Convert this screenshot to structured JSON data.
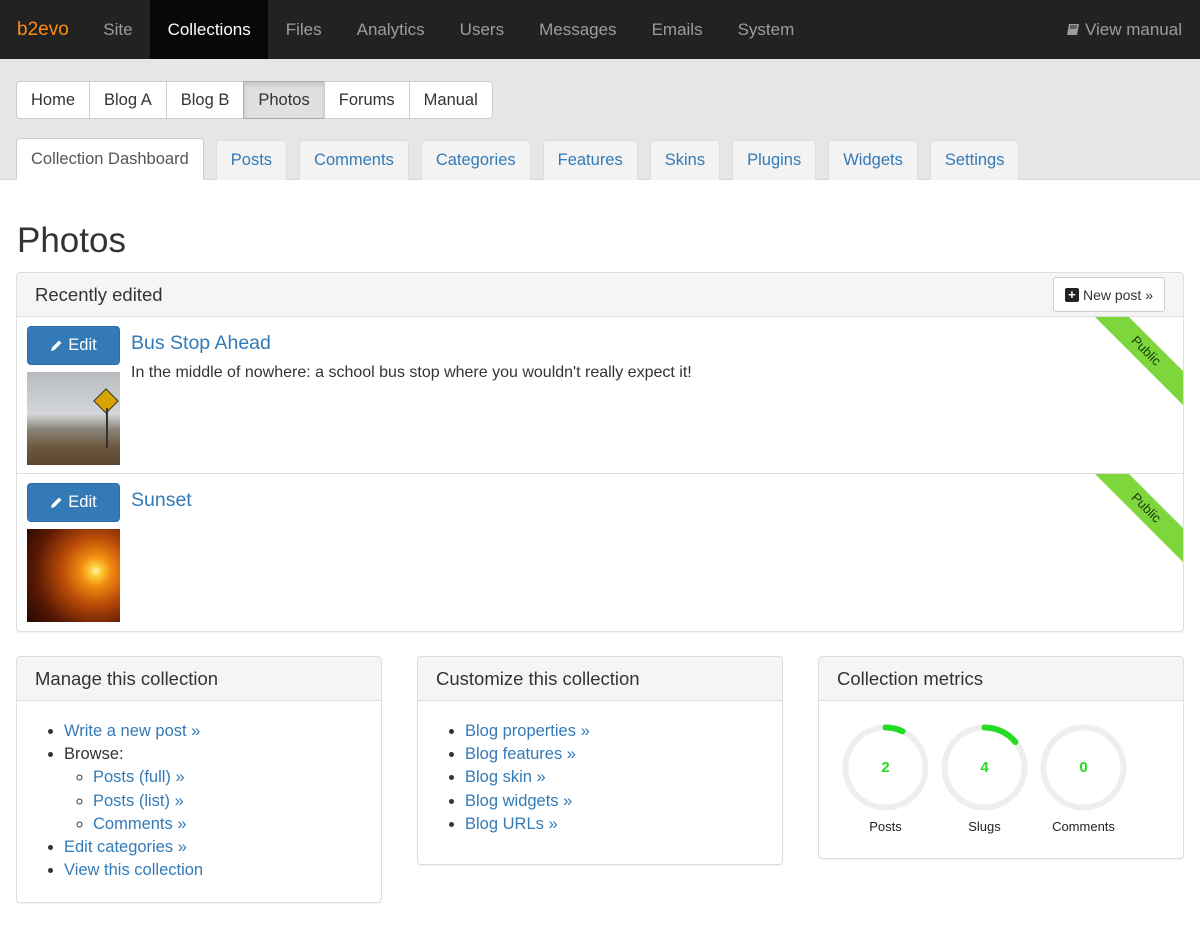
{
  "topnav": {
    "brand": "b2evo",
    "items": [
      {
        "label": "Site",
        "active": false
      },
      {
        "label": "Collections",
        "active": true
      },
      {
        "label": "Files",
        "active": false
      },
      {
        "label": "Analytics",
        "active": false
      },
      {
        "label": "Users",
        "active": false
      },
      {
        "label": "Messages",
        "active": false
      },
      {
        "label": "Emails",
        "active": false
      },
      {
        "label": "System",
        "active": false
      }
    ],
    "manual_label": "View manual",
    "manual_icon": "book-icon"
  },
  "collections": [
    {
      "label": "Home",
      "active": false
    },
    {
      "label": "Blog A",
      "active": false
    },
    {
      "label": "Blog B",
      "active": false
    },
    {
      "label": "Photos",
      "active": true
    },
    {
      "label": "Forums",
      "active": false
    },
    {
      "label": "Manual",
      "active": false
    }
  ],
  "tabs": [
    {
      "label": "Collection Dashboard",
      "active": true
    },
    {
      "label": "Posts",
      "active": false
    },
    {
      "label": "Comments",
      "active": false
    },
    {
      "label": "Categories",
      "active": false
    },
    {
      "label": "Features",
      "active": false
    },
    {
      "label": "Skins",
      "active": false
    },
    {
      "label": "Plugins",
      "active": false
    },
    {
      "label": "Widgets",
      "active": false
    },
    {
      "label": "Settings",
      "active": false
    }
  ],
  "page_title": "Photos",
  "recent": {
    "heading": "Recently edited",
    "new_post_label": "New post »",
    "edit_label": "Edit",
    "items": [
      {
        "title": "Bus Stop Ahead",
        "excerpt": "In the middle of nowhere: a school bus stop where you wouldn't really expect it!",
        "status": "Public",
        "thumb": "bus-stop-photo"
      },
      {
        "title": "Sunset",
        "excerpt": "",
        "status": "Public",
        "thumb": "sunset-photo"
      }
    ]
  },
  "manage": {
    "heading": "Manage this collection",
    "write": "Write a new post »",
    "browse": "Browse:",
    "posts_full": "Posts (full) »",
    "posts_list": "Posts (list) »",
    "comments": "Comments »",
    "edit_categories": "Edit categories »",
    "view": "View this collection"
  },
  "customize": {
    "heading": "Customize this collection",
    "links": [
      "Blog properties »",
      "Blog features »",
      "Blog skin »",
      "Blog widgets »",
      "Blog URLs »"
    ]
  },
  "metrics": {
    "heading": "Collection metrics",
    "accent": "#22dd22",
    "items": [
      {
        "label": "Posts",
        "value": "2",
        "fraction": 0.07
      },
      {
        "label": "Slugs",
        "value": "4",
        "fraction": 0.14
      },
      {
        "label": "Comments",
        "value": "0",
        "fraction": 0
      }
    ]
  }
}
